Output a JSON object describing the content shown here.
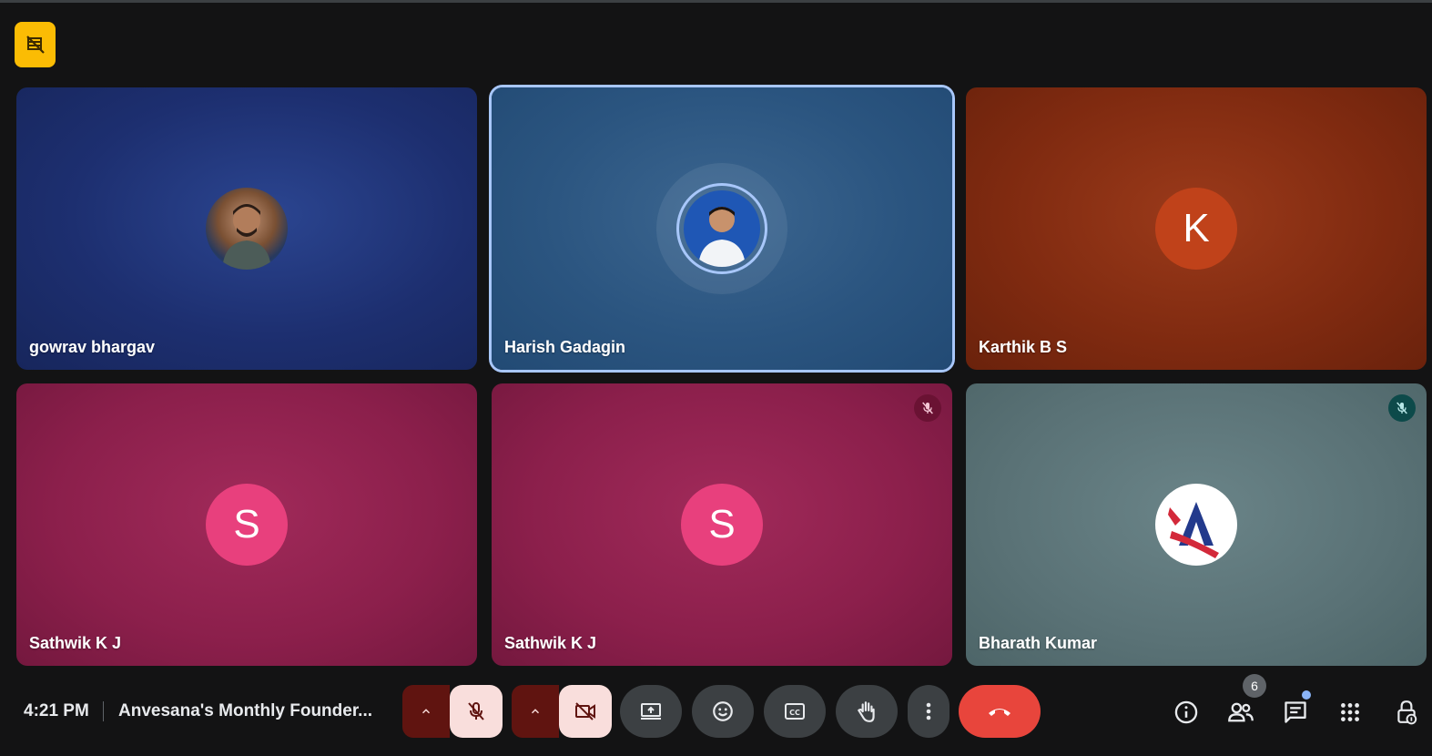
{
  "participants": [
    {
      "name": "gowrav bhargav",
      "initial": "",
      "muted": false,
      "avatar_kind": "photo"
    },
    {
      "name": "Harish Gadagin",
      "initial": "",
      "muted": false,
      "avatar_kind": "photo",
      "speaking": true
    },
    {
      "name": "Karthik B S",
      "initial": "K",
      "muted": false,
      "avatar_kind": "initial"
    },
    {
      "name": "Sathwik K J",
      "initial": "S",
      "muted": false,
      "avatar_kind": "initial"
    },
    {
      "name": "Sathwik K J",
      "initial": "S",
      "muted": true,
      "avatar_kind": "initial"
    },
    {
      "name": "Bharath Kumar",
      "initial": "",
      "muted": true,
      "avatar_kind": "logo"
    }
  ],
  "bottom_bar": {
    "time": "4:21 PM",
    "meeting_title": "Anvesana's Monthly Founder...",
    "people_count": "6"
  },
  "colors": {
    "accent": "#a8c7fa",
    "end_call": "#e8453c",
    "muted_control_bg": "#f9dedc",
    "muted_caret_bg": "#601410",
    "indicator_badge": "#fbbc04"
  },
  "icons": {
    "top_badge": "no-video-grid-icon",
    "mic": "mic-off-icon",
    "camera": "video-off-icon",
    "present": "present-screen-icon",
    "emoji": "emoji-icon",
    "captions": "captions-icon",
    "hand": "raise-hand-icon",
    "more": "more-vert-icon",
    "end": "end-call-icon",
    "info": "info-icon",
    "people": "people-icon",
    "chat": "chat-icon",
    "activities": "apps-grid-icon",
    "host": "host-controls-icon"
  }
}
